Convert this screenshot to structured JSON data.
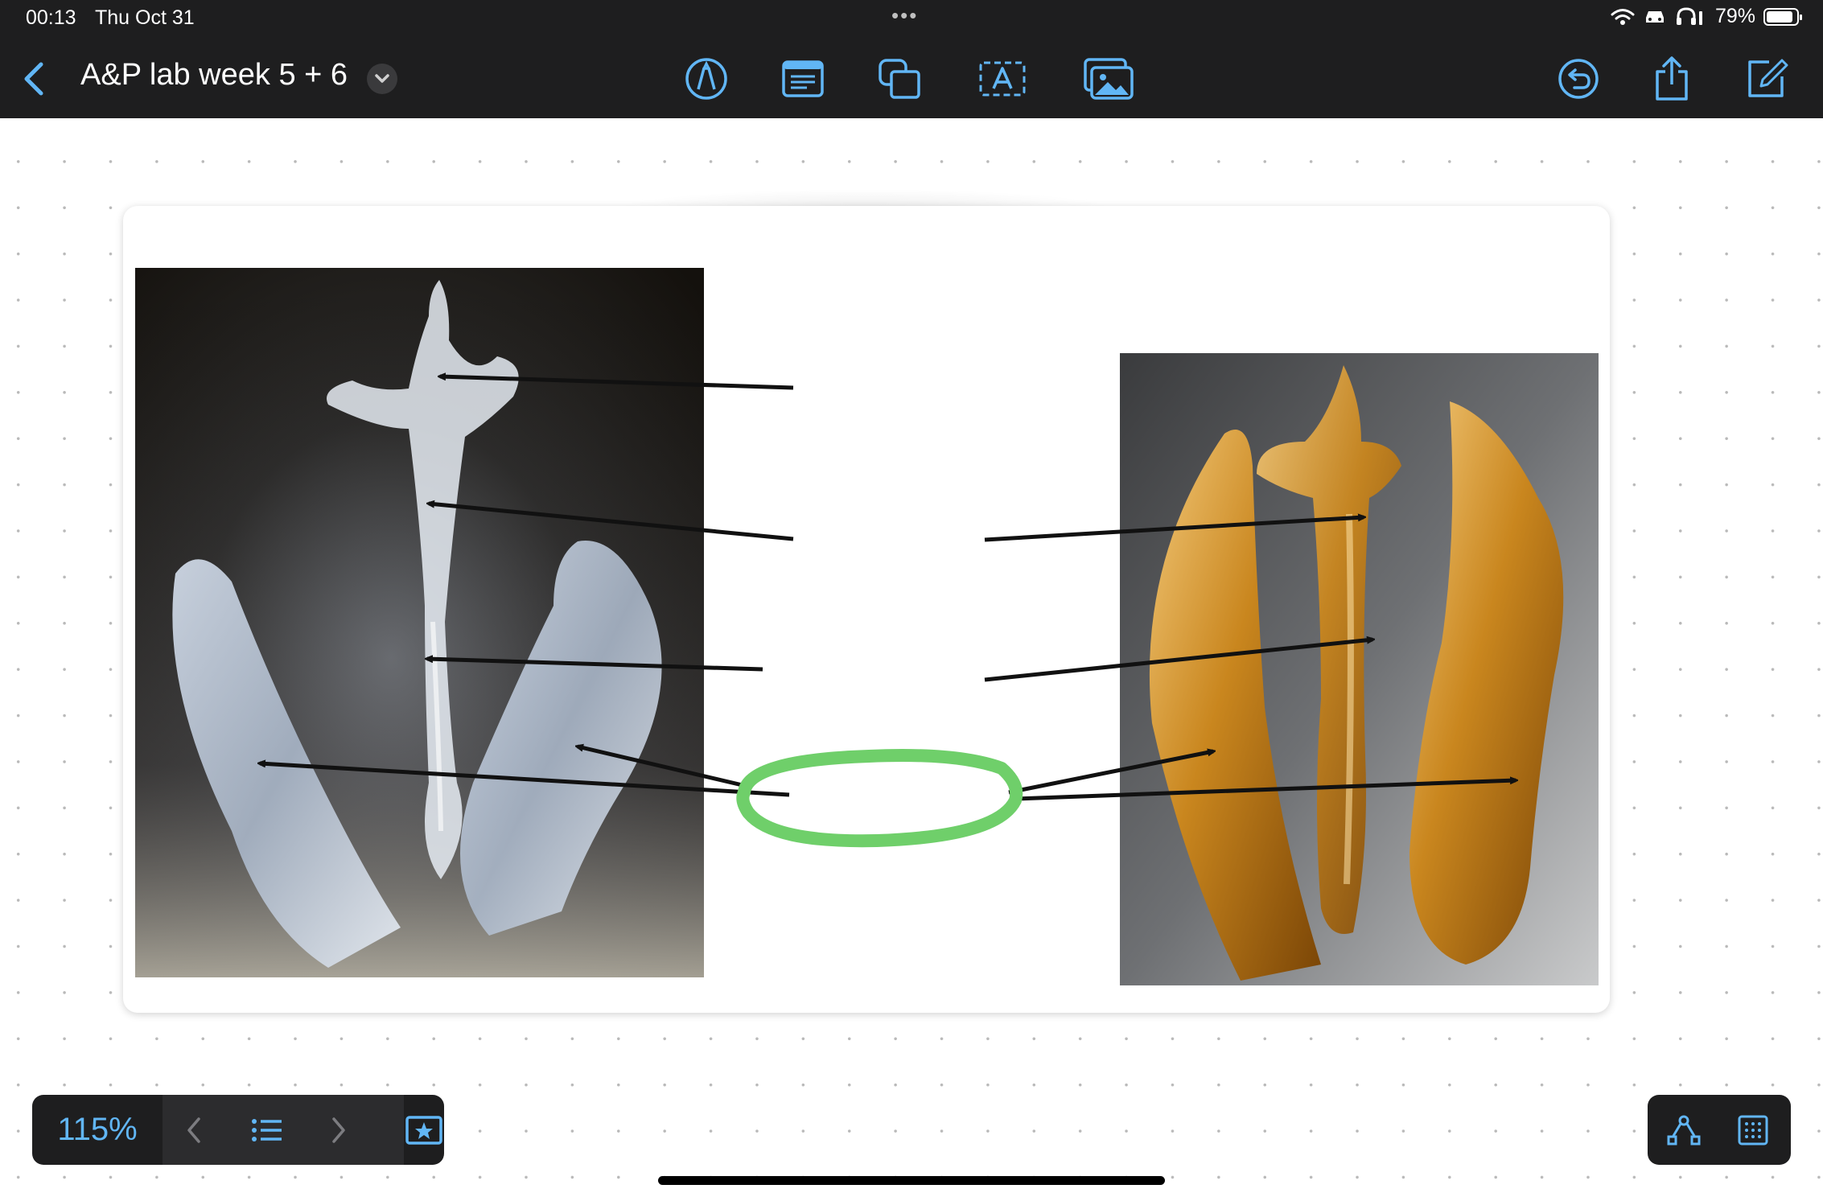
{
  "status_bar": {
    "time": "00:13",
    "date": "Thu Oct 31",
    "battery": "79%",
    "icons": [
      "wifi-icon",
      "car-icon",
      "headphones-icon",
      "battery-icon"
    ]
  },
  "toolbar": {
    "back_icon": "chevron-left-icon",
    "title": "A&P lab week 5 + 6",
    "title_menu_icon": "chevron-down-icon",
    "tools": [
      "pen-icon",
      "sticky-note-icon",
      "shapes-icon",
      "text-box-icon",
      "image-icon"
    ],
    "actions": [
      "undo-icon",
      "share-icon",
      "compose-icon"
    ]
  },
  "board": {
    "left_photo": "clear plastic larynx/nasal cavity model",
    "right_photo": "amber plastic larynx/nasal cavity model",
    "highlight_color": "#6fcf6a",
    "arrow_color": "#111111"
  },
  "bottom_bar": {
    "zoom": "115%",
    "nav": [
      "chevron-left-icon",
      "list-icon",
      "chevron-right-icon",
      "star-frame-icon"
    ],
    "tools": [
      "connector-icon",
      "grid-icon"
    ]
  },
  "colors": {
    "toolbar_bg": "#1e1e1f",
    "accent": "#61b6f5"
  }
}
